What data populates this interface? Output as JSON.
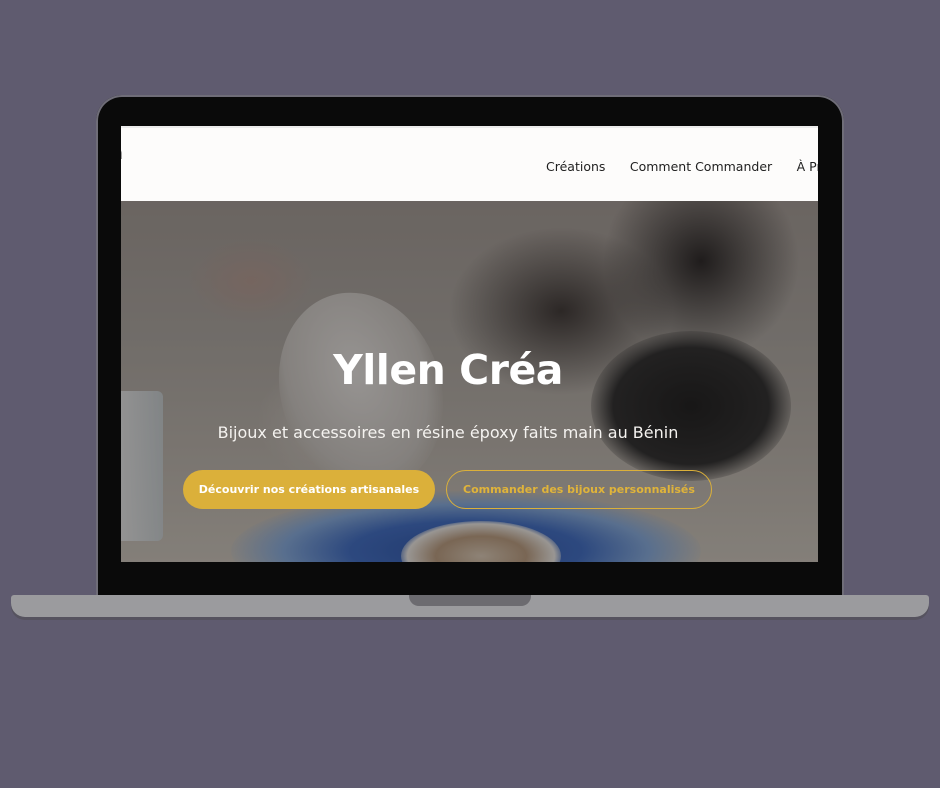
{
  "colors": {
    "page_background": "#5f5b6f",
    "accent_gold": "#dbb03a",
    "nav_background": "#fdfcfb"
  },
  "nav": {
    "logo_lines": [
      "en",
      "ea"
    ],
    "links": [
      "Créations",
      "Comment Commander",
      "À Prop"
    ]
  },
  "hero": {
    "title": "Yllen Créa",
    "subtitle": "Bijoux et accessoires en résine époxy faits main au Bénin",
    "primary_button": "Découvrir nos créations artisanales",
    "secondary_button": "Commander des bijoux personnalisés"
  }
}
